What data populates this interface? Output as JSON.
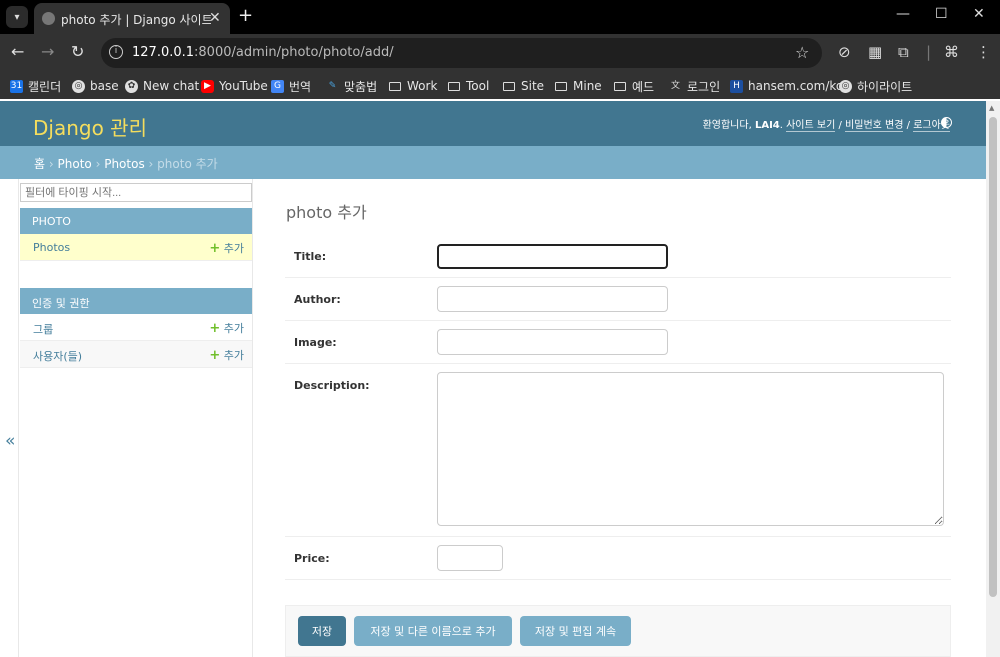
{
  "browser": {
    "tab_title": "photo 추가 | Django 사이트 관",
    "url_host": "127.0.0.1",
    "url_rest": ":8000/admin/photo/photo/add/",
    "new_tab": "+",
    "bookmarks": [
      {
        "label": "캘린더",
        "icon": "calendar-icon",
        "color": "#1a73e8"
      },
      {
        "label": "base",
        "icon": "globe-icon",
        "color": "#e0e0e0"
      },
      {
        "label": "New chat",
        "icon": "chatgpt-icon",
        "color": "#e0e0e0"
      },
      {
        "label": "YouTube",
        "icon": "youtube-icon",
        "color": "#ff0000"
      },
      {
        "label": "번역",
        "icon": "translate-icon",
        "color": "#4285f4"
      },
      {
        "label": "맞춤법",
        "icon": "spellcheck-icon",
        "color": "#4aa3df"
      },
      {
        "label": "Work",
        "icon": "folder-icon"
      },
      {
        "label": "Tool",
        "icon": "folder-icon"
      },
      {
        "label": "Site",
        "icon": "folder-icon"
      },
      {
        "label": "Mine",
        "icon": "folder-icon"
      },
      {
        "label": "예드",
        "icon": "folder-icon"
      },
      {
        "label": "로그인",
        "icon": "login-icon"
      },
      {
        "label": "hansem.com/ko/",
        "icon": "hansem-icon",
        "color": "#1c4fa0"
      },
      {
        "label": "하이라이트",
        "icon": "globe-icon"
      }
    ]
  },
  "header": {
    "branding": "Django 관리",
    "welcome": "환영합니다,",
    "username": "LAI4",
    "view_site": "사이트 보기",
    "change_password": "비밀번호 변경",
    "logout": "로그아웃",
    "sep": "/"
  },
  "breadcrumbs": {
    "home": "홈",
    "app": "Photo",
    "model": "Photos",
    "current": "photo 추가",
    "sep": "›"
  },
  "sidebar": {
    "filter_placeholder": "필터에 타이핑 시작...",
    "modules": [
      {
        "caption": "PHOTO",
        "rows": [
          {
            "name": "Photos",
            "add": "추가"
          }
        ]
      },
      {
        "caption": "인증 및 권한",
        "rows": [
          {
            "name": "그룹",
            "add": "추가"
          },
          {
            "name": "사용자(들)",
            "add": "추가"
          }
        ]
      }
    ],
    "collapse": "«"
  },
  "content": {
    "title": "photo 추가",
    "fields": {
      "title": {
        "label": "Title:",
        "value": ""
      },
      "author": {
        "label": "Author:",
        "value": ""
      },
      "image": {
        "label": "Image:",
        "value": ""
      },
      "description": {
        "label": "Description:",
        "value": ""
      },
      "price": {
        "label": "Price:",
        "value": ""
      }
    },
    "buttons": {
      "save": "저장",
      "save_add": "저장 및 다른 이름으로 추가",
      "save_continue": "저장 및 편집 계속"
    }
  },
  "colors": {
    "header_bg": "#417690",
    "branding": "#f5dd5d",
    "breadcrumbs_bg": "#79aec8",
    "add_plus": "#70bf2b"
  }
}
